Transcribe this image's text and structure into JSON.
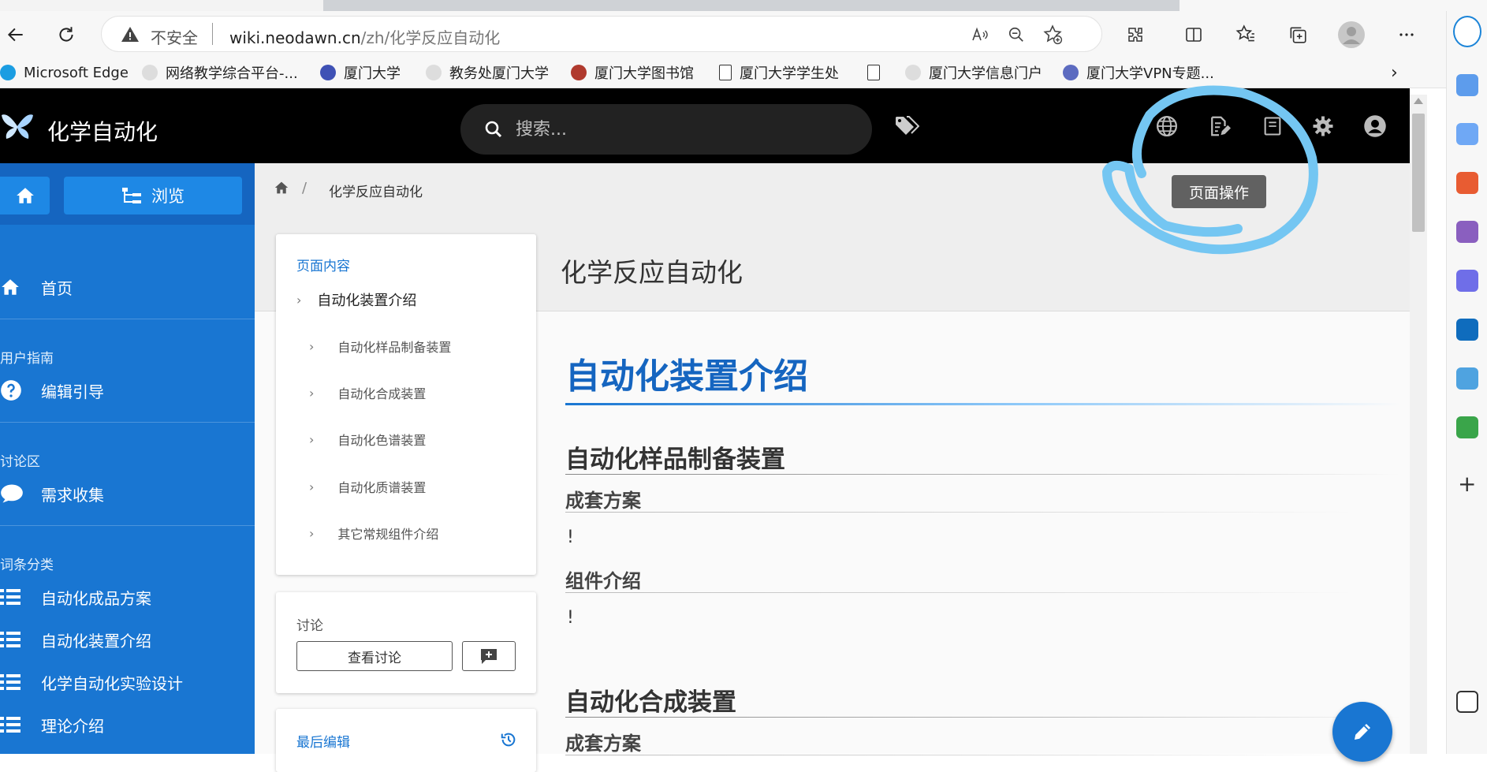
{
  "browser": {
    "address": {
      "security_label": "不安全",
      "url_host": "wiki.neodawn.cn",
      "url_path": "/zh/化学反应自动化"
    },
    "favorites": [
      {
        "label": "Microsoft Edge",
        "color": "#1b9de2"
      },
      {
        "label": "网络教学综合平台-...",
        "color": "#cccccc"
      },
      {
        "label": "厦门大学",
        "color": "#3f51b5"
      },
      {
        "label": "教务处厦门大学",
        "color": "#cccccc"
      },
      {
        "label": "厦门大学图书馆",
        "color": "#b03a2e"
      },
      {
        "label": "厦门大学学生处",
        "color": "#ffffff"
      },
      {
        "label": "",
        "color": "#ffffff"
      },
      {
        "label": "厦门大学信息门户",
        "color": "#cccccc"
      },
      {
        "label": "厦门大学VPN专题...",
        "color": "#5c6bc0"
      }
    ]
  },
  "header": {
    "site_title": "化学自动化",
    "search_placeholder": "搜索...",
    "tooltip": "页面操作",
    "annotation_color": "#74c6f2"
  },
  "nav": {
    "browse_label": "浏览",
    "home_label": "首页",
    "sections": [
      {
        "heading": "用户指南",
        "items": [
          {
            "label": "编辑引导",
            "icon": "help-circle-icon"
          }
        ]
      },
      {
        "heading": "讨论区",
        "items": [
          {
            "label": "需求收集",
            "icon": "chat-bubble-icon"
          }
        ]
      },
      {
        "heading": "词条分类",
        "items": [
          {
            "label": "自动化成品方案",
            "icon": "list-icon"
          },
          {
            "label": "自动化装置介绍",
            "icon": "list-icon"
          },
          {
            "label": "化学自动化实验设计",
            "icon": "list-icon"
          },
          {
            "label": "理论介绍",
            "icon": "list-icon"
          }
        ]
      }
    ]
  },
  "breadcrumb": {
    "current": "化学反应自动化"
  },
  "page": {
    "title": "化学反应自动化"
  },
  "toc": {
    "heading": "页面内容",
    "top": "自动化装置介绍",
    "items": [
      "自动化样品制备装置",
      "自动化合成装置",
      "自动化色谱装置",
      "自动化质谱装置",
      "其它常规组件介绍"
    ]
  },
  "discussion": {
    "label": "讨论",
    "view_button": "查看讨论"
  },
  "last_edit": {
    "label": "最后编辑"
  },
  "article": {
    "h1": "自动化装置介绍",
    "sections": [
      {
        "h2": "自动化样品制备装置",
        "subs": [
          {
            "h3": "成套方案",
            "body": "!"
          },
          {
            "h3": "组件介绍",
            "body": "!"
          }
        ]
      },
      {
        "h2": "自动化合成装置",
        "subs": [
          {
            "h3": "成套方案",
            "body": ""
          }
        ]
      }
    ]
  },
  "colors": {
    "header_bg": "#000000",
    "nav_bg": "#1976d2",
    "accent": "#1565c0"
  }
}
